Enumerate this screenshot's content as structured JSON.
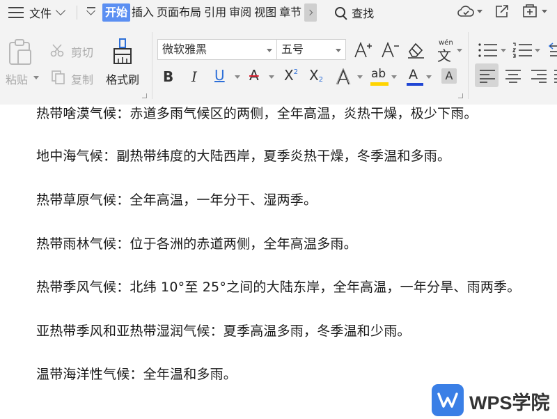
{
  "menubar": {
    "file_label": "文件",
    "tabs": [
      {
        "label": "开始",
        "active": true
      },
      {
        "label": "插入"
      },
      {
        "label": "页面布局"
      },
      {
        "label": "引用"
      },
      {
        "label": "审阅"
      },
      {
        "label": "视图"
      },
      {
        "label": "章节"
      }
    ],
    "search_label": "查找",
    "icons": [
      "menu-icon",
      "cloud-sync-icon",
      "share-icon",
      "import-icon"
    ]
  },
  "ribbon": {
    "paste_label": "粘贴",
    "cut_label": "剪切",
    "copy_label": "复制",
    "format_painter_label": "格式刷",
    "font_name": "微软雅黑",
    "font_size": "五号",
    "phonetic_guide_text": "wén"
  },
  "document": {
    "paragraphs": [
      "热带啥漠气候：赤道多雨气候区的两侧，全年高温，炎热干燥，极少下雨。",
      "地中海气候：副热带纬度的大陆西岸，夏季炎热干燥，冬季温和多雨。",
      "热带草原气候：全年高温，一年分干、湿两季。",
      "热带雨林气候：位于各洲的赤道两侧，全年高温多雨。",
      "热带季风气候：北纬 10°至 25°之间的大陆东岸，全年高温，一年分旱、雨两季。",
      "亚热带季风和亚热带湿润气候：夏季高温多雨，冬季温和少雨。",
      "温带海洋性气候：全年温和多雨。"
    ]
  },
  "watermark": {
    "label": "WPS学院"
  },
  "colors": {
    "accent": "#5b8ff2",
    "toolbar_bg": "#f3f3f3",
    "highlight_yellow": "#ffd400",
    "font_color_blue": "#2046d4",
    "wps_blue": "#3a7fe6"
  }
}
